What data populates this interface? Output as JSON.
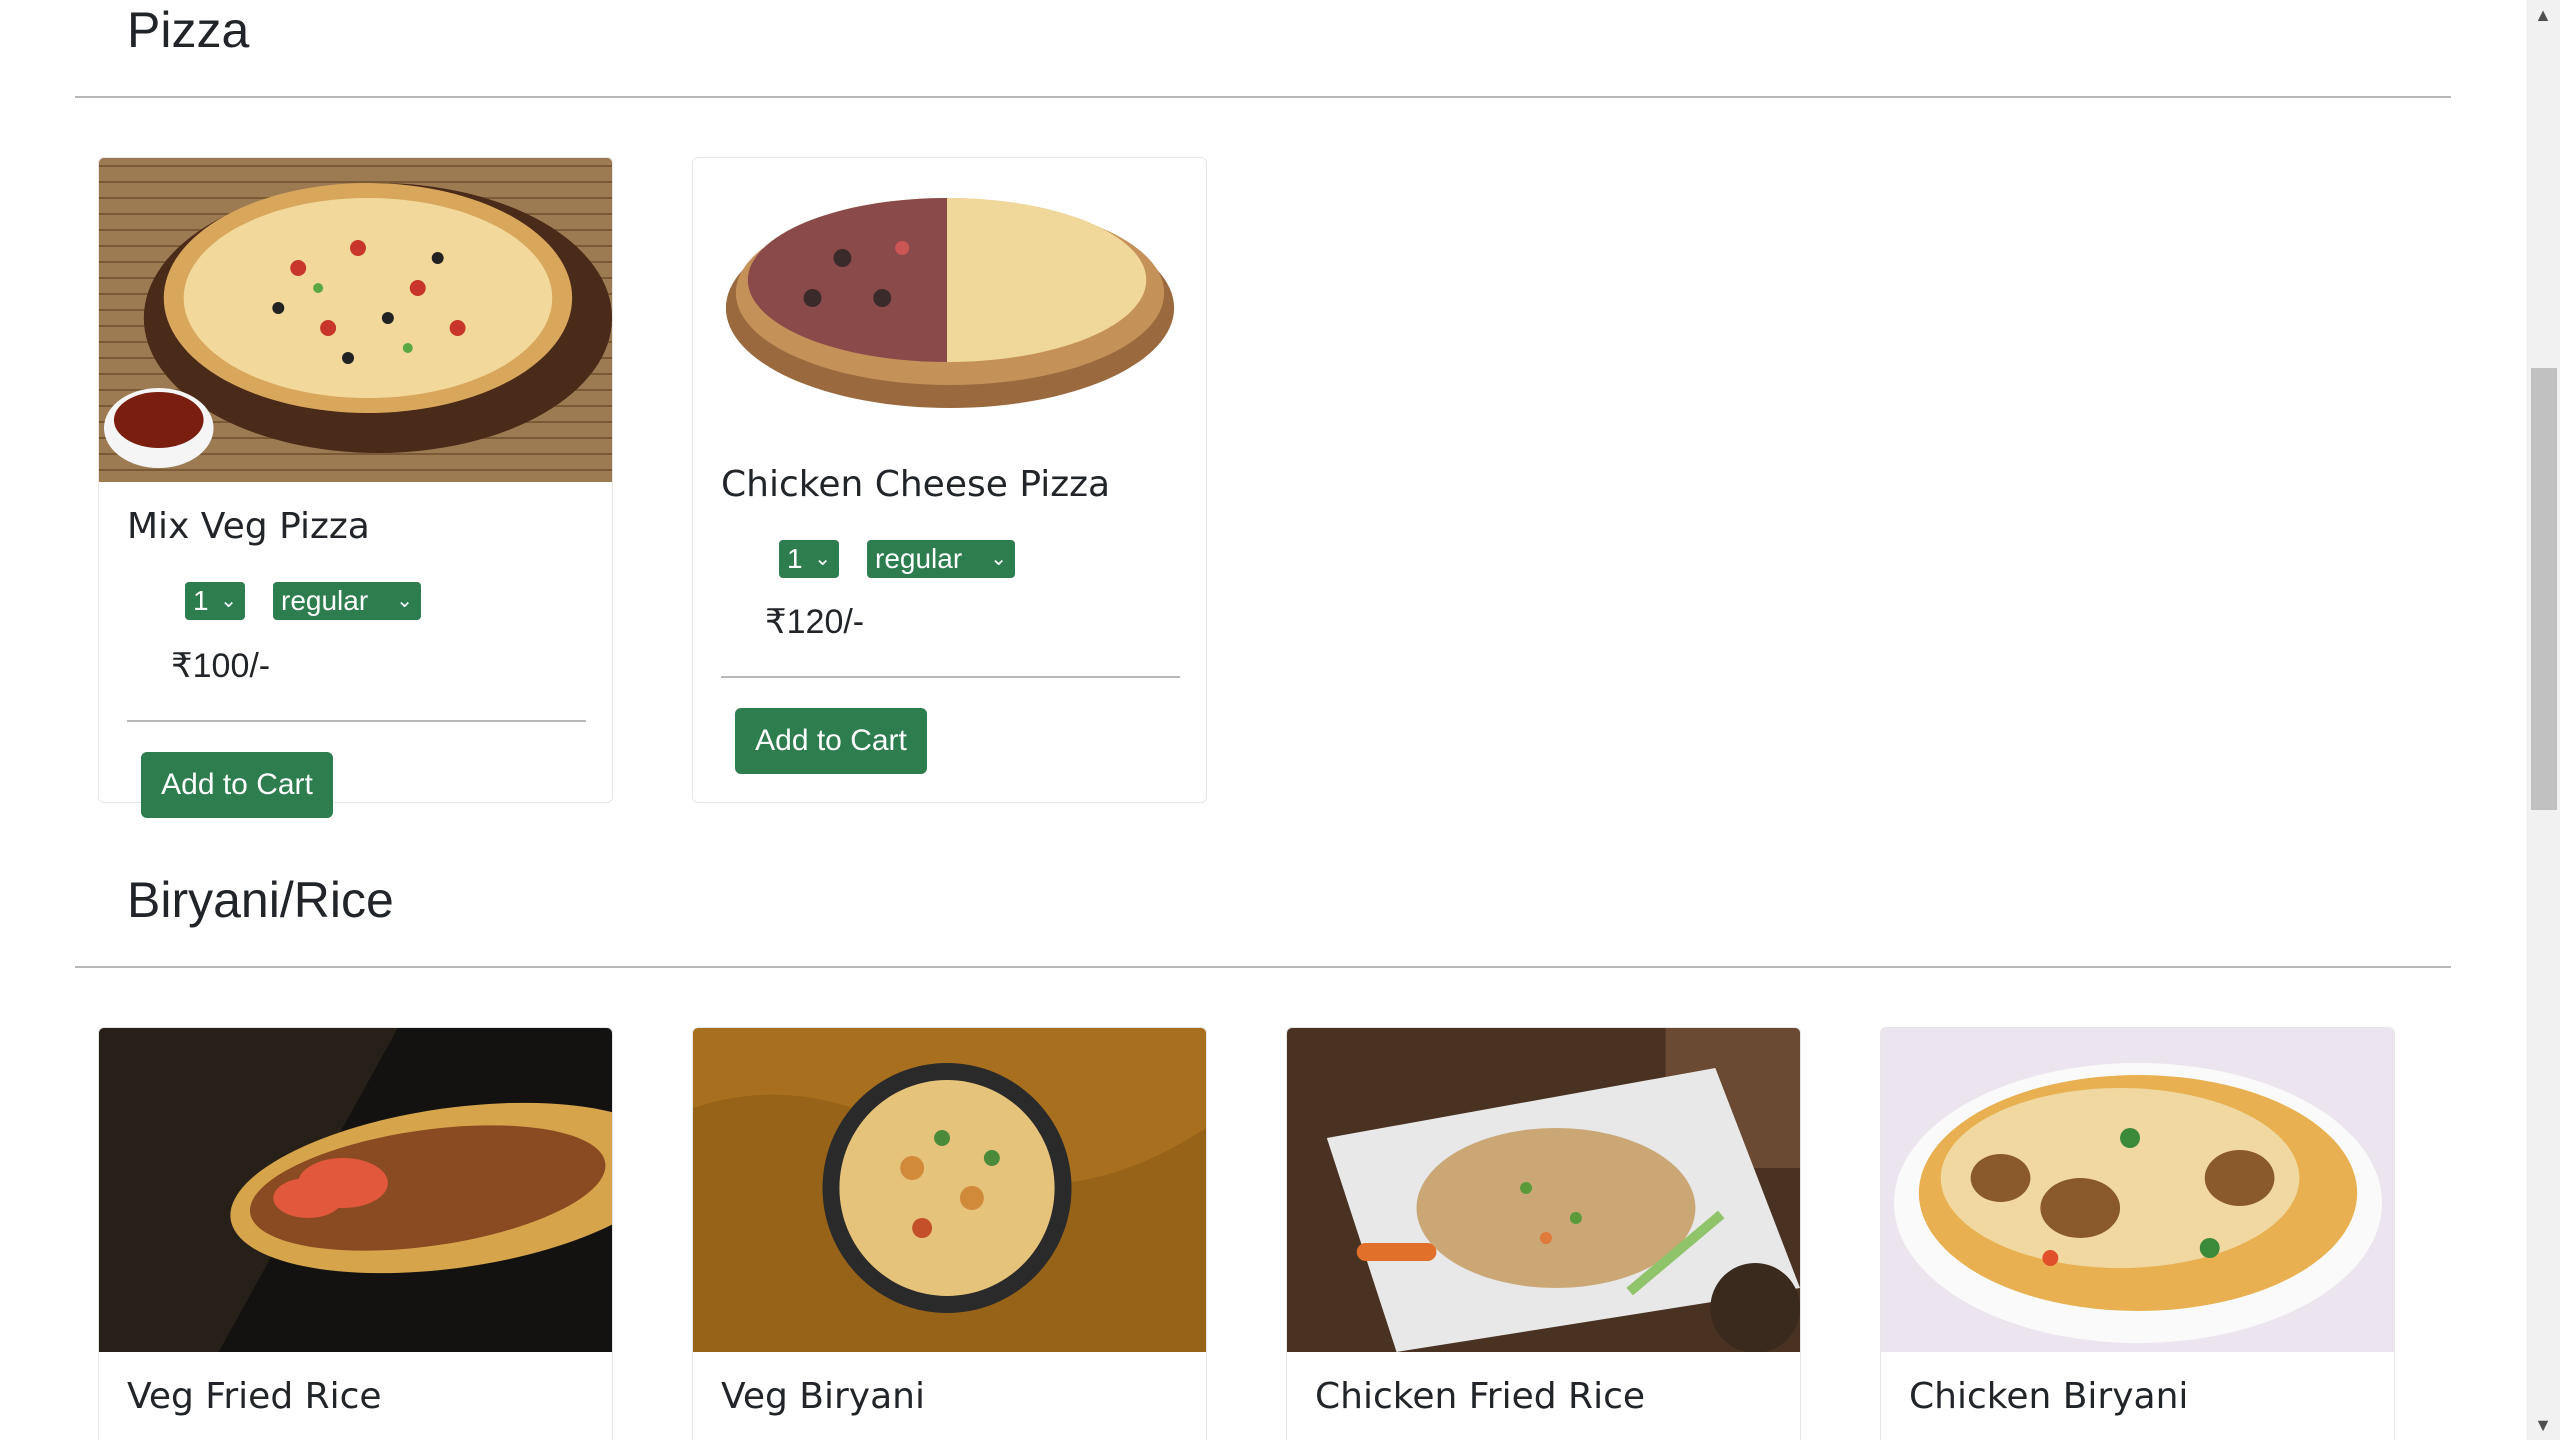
{
  "sections": [
    {
      "title": "Pizza",
      "items": [
        {
          "name": "Mix Veg Pizza",
          "qty": "1",
          "size": "regular",
          "price": "₹100/-",
          "button": "Add to Cart"
        },
        {
          "name": "Chicken Cheese Pizza",
          "qty": "1",
          "size": "regular",
          "price": "₹120/-",
          "button": "Add to Cart"
        }
      ]
    },
    {
      "title": "Biryani/Rice",
      "items": [
        {
          "name": "Veg Fried Rice"
        },
        {
          "name": "Veg Biryani"
        },
        {
          "name": "Chicken Fried Rice"
        },
        {
          "name": "Chicken Biryani"
        }
      ]
    }
  ],
  "icons": {
    "dropdown": "chevron-down-icon",
    "scroll_up": "scroll-up-arrow-icon",
    "scroll_down": "scroll-down-arrow-icon"
  },
  "colors": {
    "accent": "#2e7d4f",
    "rule": "#b8b8b8",
    "text": "#212529"
  }
}
